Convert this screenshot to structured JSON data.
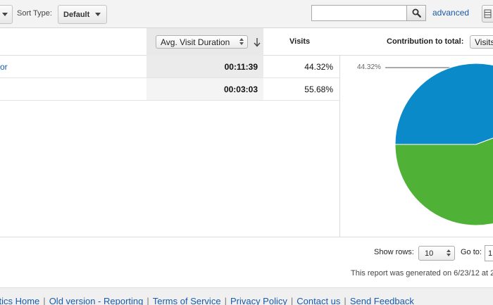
{
  "toolbar": {
    "sort_type_label": "Sort Type:",
    "sort_type_value": "Default",
    "search": {
      "value": "",
      "placeholder": ""
    },
    "advanced_label": "advanced"
  },
  "table": {
    "sorted_metric": "Avg. Visit Duration",
    "columns": {
      "visits": "Visits",
      "contribution": "Contribution to total:",
      "contribution_select": "Visits"
    },
    "rows": [
      {
        "label": "or",
        "duration": "00:11:39",
        "visits_pct": "44.32%"
      },
      {
        "label": "",
        "duration": "00:03:03",
        "visits_pct": "55.68%"
      }
    ]
  },
  "pie": {
    "label": "44.32%",
    "slices": [
      {
        "value": 44.32,
        "color": "#0a8ac8"
      },
      {
        "value": 55.68,
        "color": "#4fb237"
      }
    ]
  },
  "pager": {
    "show_rows_label": "Show rows:",
    "show_rows_value": "10",
    "goto_label": "Go to:",
    "goto_value": "1",
    "generated": "This report was generated on 6/23/12 at 2"
  },
  "footer": {
    "links": [
      "ytics Home",
      "Old version - Reporting",
      "Terms of Service",
      "Privacy Policy",
      "Contact us",
      "Send Feedback"
    ]
  }
}
